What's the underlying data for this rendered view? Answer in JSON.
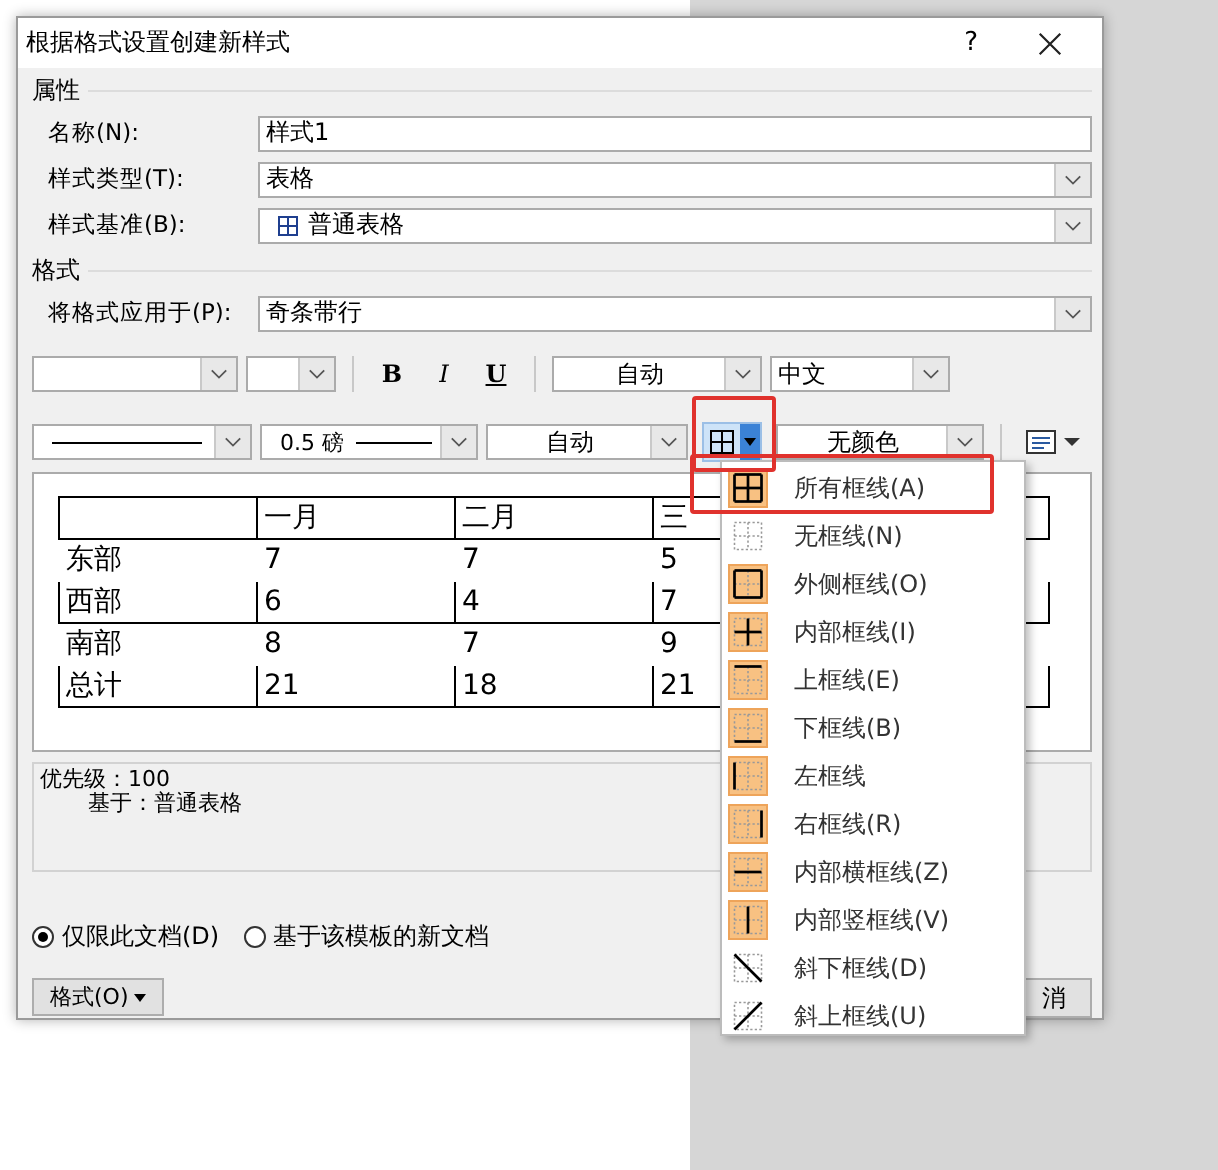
{
  "window": {
    "title": "根据格式设置创建新样式",
    "help": "?"
  },
  "properties": {
    "heading": "属性",
    "fields": [
      {
        "label": "名称(N):",
        "value": "样式1",
        "kind": "text"
      },
      {
        "label": "样式类型(T):",
        "value": "表格",
        "kind": "dropdown"
      },
      {
        "label": "样式基准(B):",
        "value": "普通表格",
        "kind": "table_dropdown"
      }
    ]
  },
  "format": {
    "heading": "格式",
    "apply_label": "将格式应用于(P):",
    "apply_value": "奇条带行",
    "font_toolbar": {
      "bold": "B",
      "italic": "I",
      "underline": "U",
      "font_color_label": "自动",
      "script": "中文"
    },
    "border_toolbar": {
      "weight": "0.5 磅",
      "border_color_label": "自动",
      "border_button_highlighted": true,
      "shading": "无颜色"
    }
  },
  "preview": {
    "columns": [
      "",
      "一月",
      "二月",
      "三"
    ],
    "rows": [
      {
        "cells": [
          "东部",
          "7",
          "7",
          "5"
        ],
        "bordered": false
      },
      {
        "cells": [
          "西部",
          "6",
          "4",
          "7"
        ],
        "bordered": true
      },
      {
        "cells": [
          "南部",
          "8",
          "7",
          "9"
        ],
        "bordered": false
      },
      {
        "cells": [
          "总计",
          "21",
          "18",
          "21"
        ],
        "bordered": true
      }
    ]
  },
  "description": [
    "优先级：100",
    "基于：普通表格"
  ],
  "scope": [
    {
      "label": "仅限此文档(D)",
      "selected": true
    },
    {
      "label": "基于该模板的新文档",
      "selected": false
    }
  ],
  "format_button": "格式(O)",
  "cancel_button": "消",
  "border_menu": [
    {
      "label": "所有框线(A)",
      "kind": "all",
      "active": true,
      "selected": true
    },
    {
      "label": "无框线(N)",
      "kind": "none",
      "active": false,
      "selected": false
    },
    {
      "label": "外侧框线(O)",
      "kind": "outside",
      "active": true,
      "selected": false
    },
    {
      "label": "内部框线(I)",
      "kind": "inside",
      "active": true,
      "selected": false
    },
    {
      "label": "上框线(E)",
      "kind": "top",
      "active": true,
      "selected": false
    },
    {
      "label": "下框线(B)",
      "kind": "bottom",
      "active": true,
      "selected": false
    },
    {
      "label": "左框线",
      "kind": "left",
      "active": true,
      "selected": false
    },
    {
      "label": "右框线(R)",
      "kind": "right",
      "active": true,
      "selected": false
    },
    {
      "label": "内部横框线(Z)",
      "kind": "inside_h",
      "active": true,
      "selected": false
    },
    {
      "label": "内部竖框线(V)",
      "kind": "inside_v",
      "active": true,
      "selected": false
    },
    {
      "label": "斜下框线(D)",
      "kind": "diag_down",
      "active": false,
      "selected": false
    },
    {
      "label": "斜上框线(U)",
      "kind": "diag_up",
      "active": false,
      "selected": false
    }
  ]
}
